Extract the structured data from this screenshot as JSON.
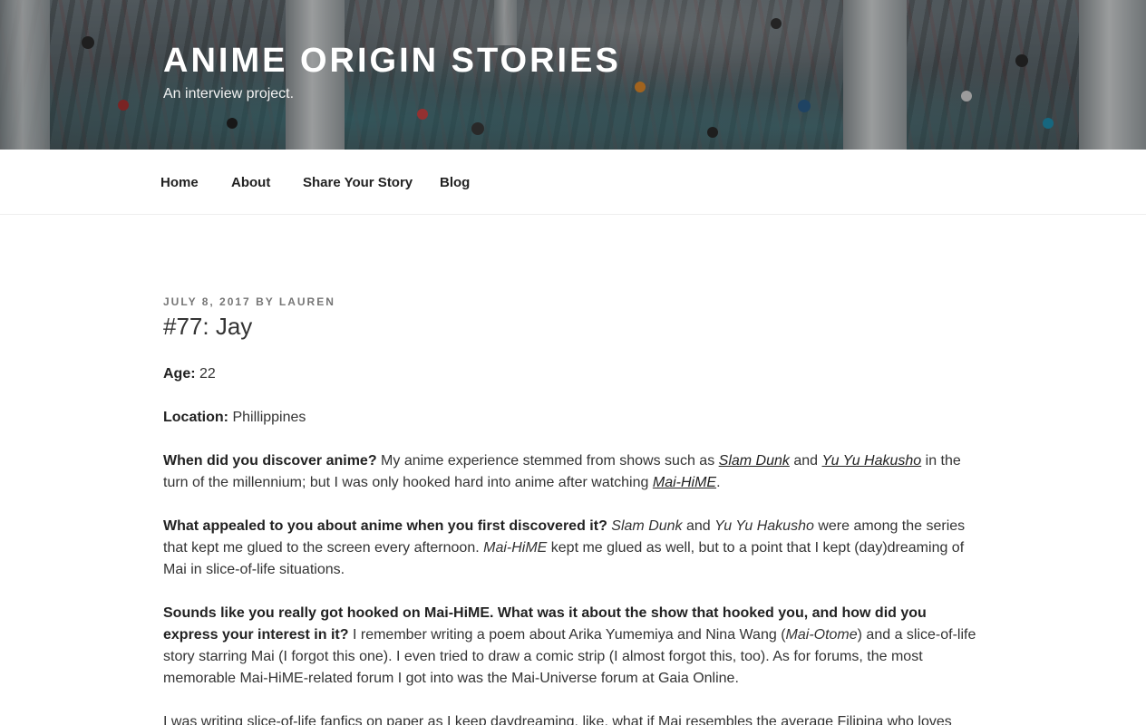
{
  "site": {
    "title": "ANIME ORIGIN STORIES",
    "description": "An interview project."
  },
  "nav": {
    "items": [
      {
        "label": "Home"
      },
      {
        "label": "About"
      },
      {
        "label": "Share Your Story"
      },
      {
        "label": "Blog"
      }
    ]
  },
  "post": {
    "date": "JULY 8, 2017",
    "by": "BY",
    "author": "LAUREN",
    "title": "#77: Jay",
    "age_label": "Age:",
    "age_value": "22",
    "location_label": "Location:",
    "location_value": "Phillippines",
    "q1": "When did you discover anime?",
    "a1_part1": "My anime experience stemmed from shows such as",
    "a1_link1": "Slam Dunk",
    "a1_and": "and",
    "a1_link2": "Yu Yu Hakusho",
    "a1_part2": "in the turn of the millennium; but I was only hooked hard into anime after watching",
    "a1_link3": "Mai-HiME",
    "a1_end": ".",
    "q2": "What appealed to you about anime when you first discovered it?",
    "a2_em1": "Slam Dunk",
    "a2_and": "and",
    "a2_em2": "Yu Yu Hakusho",
    "a2_part1": "were among the series that kept me glued to the screen every afternoon.",
    "a2_em3": "Mai-HiME",
    "a2_part2": "kept me glued as well, but to a point that I kept (day)dreaming of Mai in slice-of-life situations.",
    "q3": "Sounds like you really got hooked on Mai-HiME. What was it about the show that hooked you, and how did you express your interest in it?",
    "a3_part1": "I remember writing a poem about Arika Yumemiya and Nina Wang (",
    "a3_em1": "Mai-Otome",
    "a3_part2": ") and a slice-of-life story starring Mai (I forgot this one). I even tried to draw a comic strip (I almost forgot this, too). As for forums, the most memorable Mai-HiME-related forum I got into was the Mai-Universe forum at Gaia Online.",
    "p_last": "I was writing slice-of-life fanfics on paper as I keep daydreaming, like, what if Mai resembles the average Filipina who loves"
  }
}
